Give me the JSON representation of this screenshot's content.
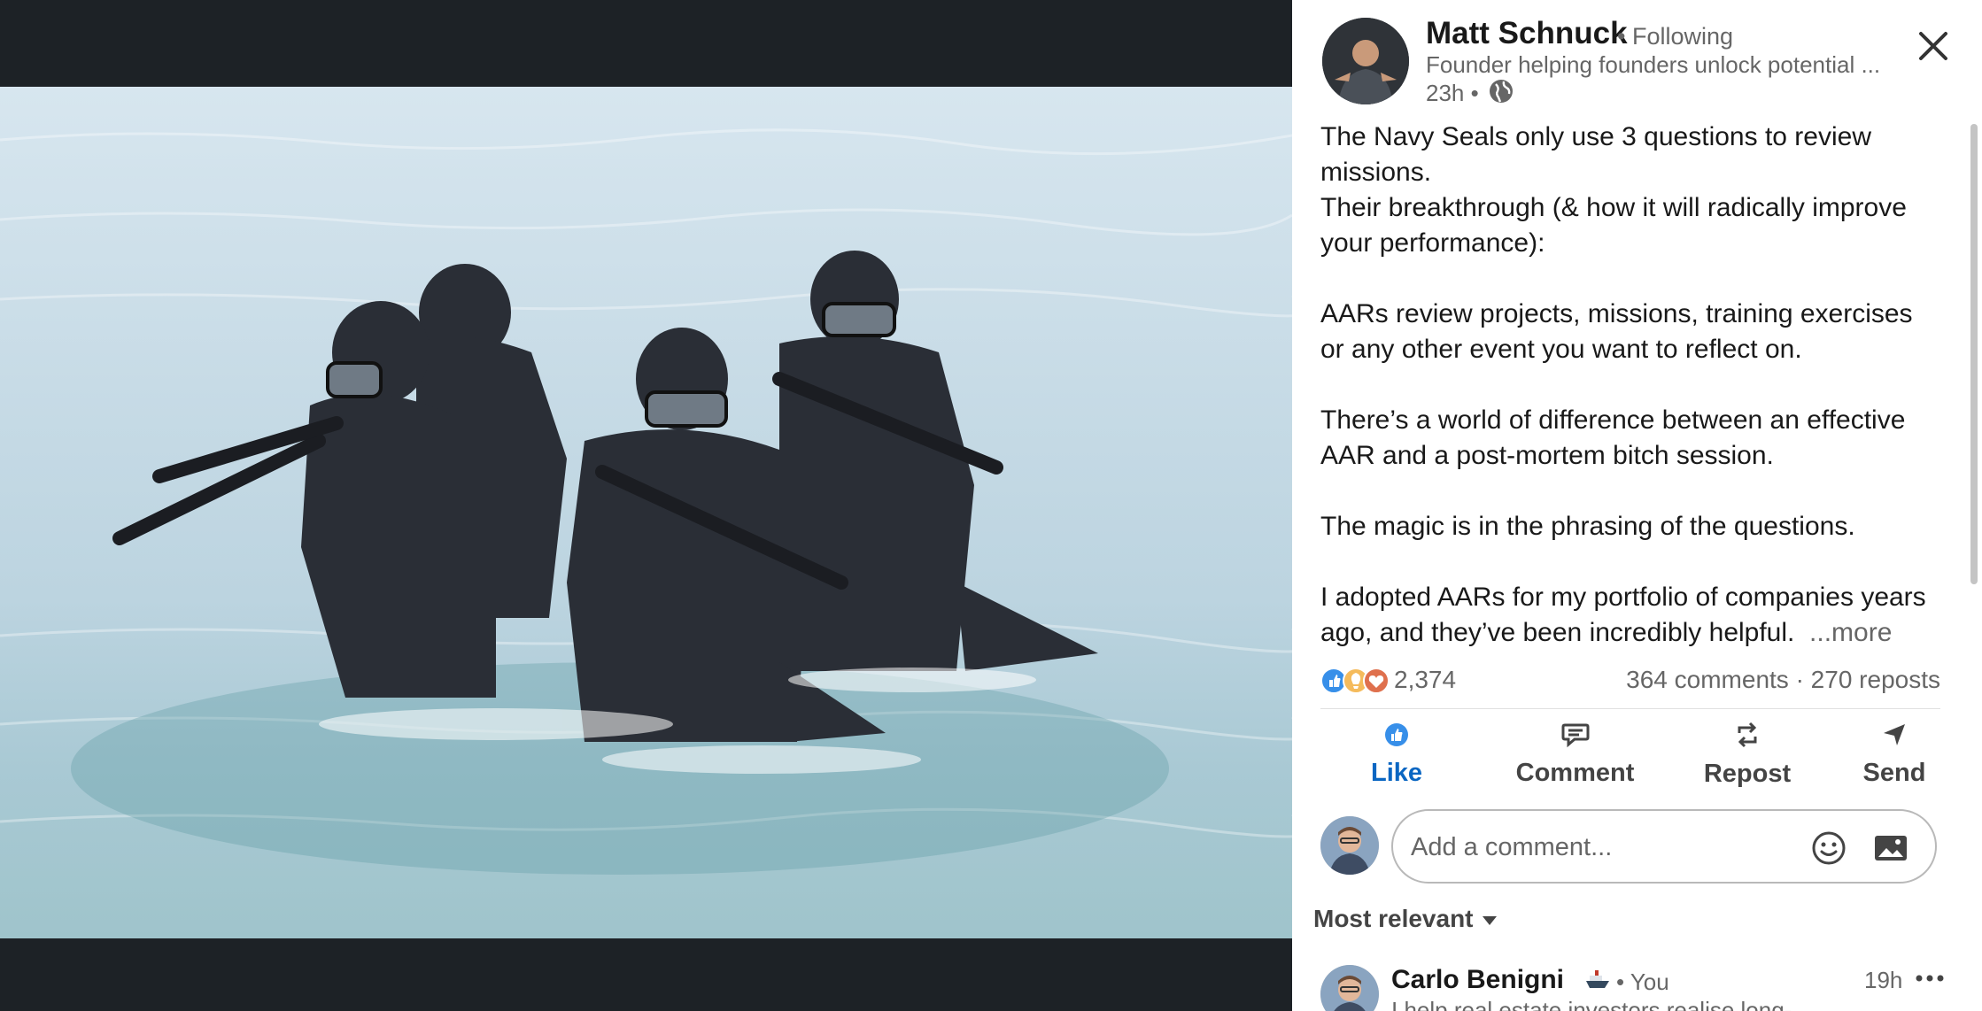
{
  "post": {
    "author": {
      "name": "Matt Schnuck",
      "follow_status": "• Following",
      "headline": "Founder helping founders unlock potential ...",
      "time": "23h •"
    },
    "body": [
      "The Navy Seals only use 3 questions to review missions.",
      "Their breakthrough (& how it will radically improve your performance):",
      "",
      "AARs review projects, missions, training exercises or any other event you want to reflect on.",
      "",
      "There’s a world of difference between an effective AAR and a post-mortem bitch session.",
      "",
      "The magic is in the phrasing of the questions.",
      "",
      "I adopted AARs for my portfolio of companies years ago, and they’ve been incredibly helpful."
    ],
    "more_label": "...more",
    "reactions_count": "2,374",
    "comments_reposts": "364 comments · 270 reposts",
    "reaction_icons": [
      "like-icon",
      "insightful-icon",
      "love-icon"
    ]
  },
  "actions": {
    "like": "Like",
    "comment": "Comment",
    "repost": "Repost",
    "send": "Send"
  },
  "composer": {
    "placeholder": "Add a comment..."
  },
  "comments": {
    "sort_label": "Most relevant",
    "items": [
      {
        "name": "Carlo Benigni",
        "badge": "• You",
        "headline": "I help real estate investors realise long-",
        "time": "19h"
      }
    ]
  },
  "colors": {
    "accent": "#0a66c2",
    "media_background": "#1d2226",
    "text_primary": "#191919",
    "text_secondary": "#666666"
  }
}
